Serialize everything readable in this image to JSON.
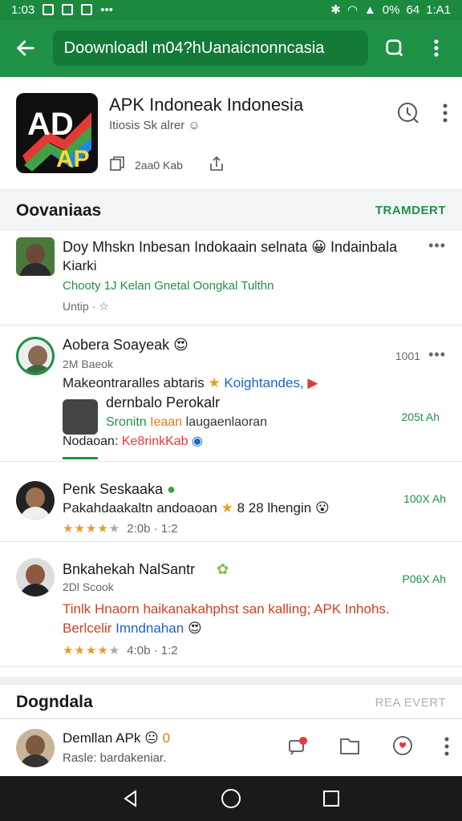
{
  "status_bar": {
    "time_left": "1:03",
    "battery": "0%",
    "signal_text": "64",
    "time_right": "1:A1"
  },
  "app_bar": {
    "url": "Dоownloadl m04?hUanaicnonncasia"
  },
  "app": {
    "title": "APK Indoneak Indonesia",
    "subtitle": "Itiosis Sk alrer",
    "size": "2aa0 Kab",
    "logo_text": "AD"
  },
  "sections": [
    {
      "title": "Oovaniaas",
      "action": "TRAMDERT"
    },
    {
      "title": "Dogndala",
      "action": "REA EVERT"
    }
  ],
  "posts": [
    {
      "name": "Doy Mhskn Inbesan Indokaain selnata",
      "name_cont": "Kiarki",
      "name_suffix": "Indainbala",
      "tags": "Chooty 1J Kelan  Gnetal  Oongkal Tulthn",
      "footer": "Untip"
    },
    {
      "name": "Aobera Soayeak",
      "sub": "2M Baeok",
      "time": "1001",
      "body": "Makeontraralles abtaris",
      "body_link": "Koightandes,",
      "nested_name": "dernbalo Perokalr",
      "nested_tags": "Sronitn",
      "nested_tags2": "Ieaan",
      "nested_text": "laugaenlaoran",
      "nested_meta": "205t Ah",
      "footer": "Nodaoan:",
      "footer_link": "Ke8rinkKab"
    },
    {
      "name": "Penk Seskaaka",
      "body": "Pakahdaakaltn andoaoan",
      "body_extra": "8 28 lhengin",
      "rating_meta": "2:0b · 1:2",
      "meta": "100X Ah"
    },
    {
      "name": "Bnkahekah NalSantr",
      "sub": "2Dl Scook",
      "body": "Tinlk Hnaorn haikanakahphst san kalling;",
      "body_link": "APK Inhohs.",
      "body2": "Berlcelir",
      "body2_link": "Imndnahan",
      "rating_meta": "4:0b · 1:2",
      "meta": "P06X Ah"
    }
  ],
  "bottom_bar": {
    "name": "Demllan APk",
    "badge": "0",
    "sub": "Rasle: bardakeniar."
  },
  "colors": {
    "primary": "#1f9147",
    "primary_dark": "#1b8a3f",
    "star": "#e89b2c"
  }
}
